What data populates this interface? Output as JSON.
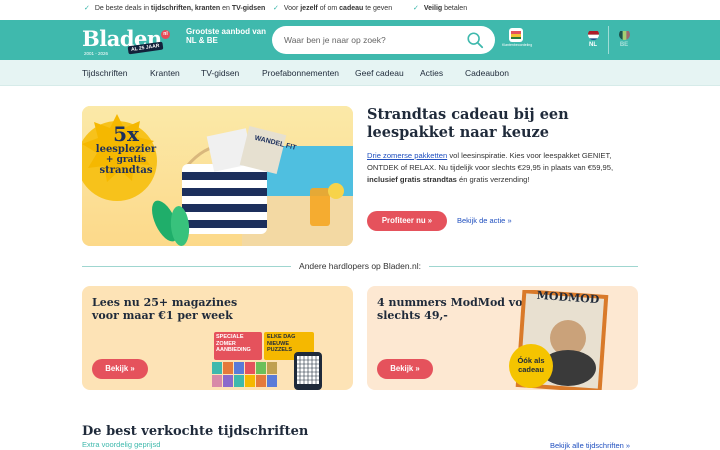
{
  "usps": [
    {
      "pre": "De beste deals in ",
      "bold": "tijdschriften, kranten",
      "mid": " en ",
      "bold2": "TV-gidsen",
      "post": ""
    },
    {
      "pre": "Grootste aanbod van NL & BE",
      "bold": "",
      "mid": "",
      "bold2": "",
      "post": ""
    },
    {
      "pre": "Voor ",
      "bold": "jezelf",
      "mid": " of om ",
      "bold2": "cadeau",
      "post": " te geven"
    },
    {
      "pre": "",
      "bold": "Veilig",
      "mid": " betalen",
      "bold2": "",
      "post": ""
    }
  ],
  "header": {
    "logo_text": "Bladen",
    "logo_years": "2001 - 2026",
    "logo_badge": "AL 25 JAAR",
    "logo_dot": "nl",
    "tagline": "Grootste aanbod van NL & BE",
    "search_placeholder": "Waar ben je naar op zoek?",
    "award_text": "Klantenbeoordeling",
    "lang_nl": "NL",
    "lang_be": "BE"
  },
  "nav": [
    "Tijdschriften",
    "Kranten",
    "TV-gidsen",
    "Proefabonnementen",
    "Geef cadeau",
    "Acties",
    "Cadeaubon"
  ],
  "hero": {
    "badge_line1": "5x",
    "badge_line2": "leesplezier",
    "badge_line3": "+ gratis",
    "badge_line4": "strandtas",
    "mag_label": "WANDEL FIT",
    "title": "Strandtas cadeau bij een leespakket naar keuze",
    "body_link": "Drie zomerse pakketten",
    "body_1": " vol leesinspiratie. Kies voor leespakket GENIET, ONTDEK of RELAX. Nu tijdelijk voor slechts €29,95 in plaats van €59,95, ",
    "body_bold": "inclusief gratis strandtas",
    "body_2": " én gratis verzending!",
    "cta": "Profiteer nu »",
    "secondary": "Bekijk de actie »"
  },
  "divider": "Andere hardlopers op Bladen.nl:",
  "promo_left": {
    "title": "Lees nu 25+ magazines voor maar €1 per week",
    "button": "Bekijk »",
    "label1": "SPECIALE ZOMER AANBIEDING",
    "label2": "ELKE DAG NIEUWE PUZZELS"
  },
  "promo_right": {
    "title": "4 nummers ModMod voor slechts 49,-",
    "button": "Bekijk »",
    "mag_name": "MODMOD",
    "sticker": "Óók als cadeau"
  },
  "bestsellers": {
    "title": "De best verkochte tijdschriften",
    "subtitle": "Extra voordelig geprijsd",
    "link": "Bekijk alle tijdschriften »"
  },
  "colors": {
    "teal": "#3fb9ad",
    "red_button": "#e5525c",
    "navy": "#1f2a3a",
    "link_blue": "#1f4fbf"
  }
}
